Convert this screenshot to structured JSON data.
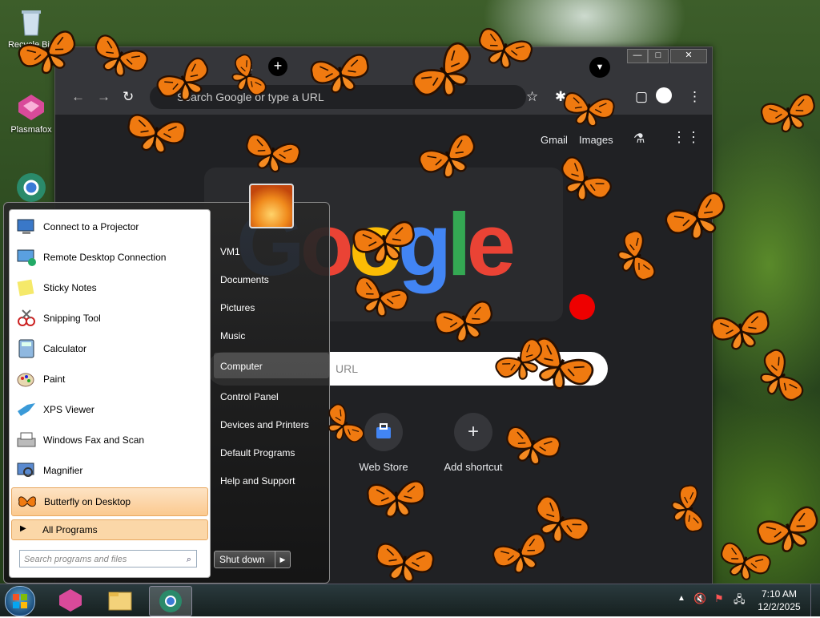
{
  "desktop": {
    "icons": [
      {
        "label": "Recycle Bin"
      },
      {
        "label": "Plasmafox"
      }
    ]
  },
  "browser": {
    "omnibox_placeholder": "Search Google or type a URL",
    "links": {
      "gmail": "Gmail",
      "images": "Images"
    },
    "logo_text": "Google",
    "search_placeholder": "URL",
    "shortcuts": [
      {
        "label": "Web Store"
      },
      {
        "label": "Add shortcut"
      }
    ]
  },
  "start_menu": {
    "programs": [
      {
        "label": "Connect to a Projector",
        "icon": "projector-icon"
      },
      {
        "label": "Remote Desktop Connection",
        "icon": "remote-desktop-icon"
      },
      {
        "label": "Sticky Notes",
        "icon": "sticky-notes-icon"
      },
      {
        "label": "Snipping Tool",
        "icon": "snipping-tool-icon"
      },
      {
        "label": "Calculator",
        "icon": "calculator-icon"
      },
      {
        "label": "Paint",
        "icon": "paint-icon"
      },
      {
        "label": "XPS Viewer",
        "icon": "xps-viewer-icon"
      },
      {
        "label": "Windows Fax and Scan",
        "icon": "fax-scan-icon"
      },
      {
        "label": "Magnifier",
        "icon": "magnifier-icon"
      },
      {
        "label": "Butterfly on Desktop",
        "icon": "butterfly-icon"
      }
    ],
    "all_programs": "All Programs",
    "search_placeholder": "Search programs and files",
    "right_links": [
      "VM1",
      "Documents",
      "Pictures",
      "Music",
      "Computer",
      "Control Panel",
      "Devices and Printers",
      "Default Programs",
      "Help and Support"
    ],
    "shutdown_label": "Shut down"
  },
  "taskbar": {
    "time": "7:10 AM",
    "date": "12/2/2025"
  },
  "colors": {
    "butterfly": "#f07a10",
    "highlight": "#fbc98f",
    "browser_bg": "#202124"
  }
}
